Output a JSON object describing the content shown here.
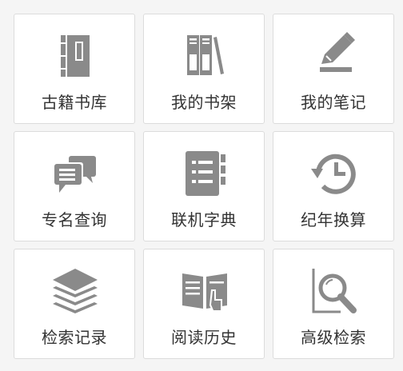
{
  "icon_color": "#8a8a8a",
  "tiles": [
    {
      "label": "古籍书库",
      "icon": "thread-bound-book-icon"
    },
    {
      "label": "我的书架",
      "icon": "bookshelf-icon"
    },
    {
      "label": "我的笔记",
      "icon": "pencil-note-icon"
    },
    {
      "label": "专名查询",
      "icon": "chat-bubbles-icon"
    },
    {
      "label": "联机字典",
      "icon": "notebook-dictionary-icon"
    },
    {
      "label": "纪年换算",
      "icon": "history-clock-icon"
    },
    {
      "label": "检索记录",
      "icon": "layers-icon"
    },
    {
      "label": "阅读历史",
      "icon": "open-book-pointer-icon"
    },
    {
      "label": "高级检索",
      "icon": "magnifier-search-icon"
    }
  ]
}
